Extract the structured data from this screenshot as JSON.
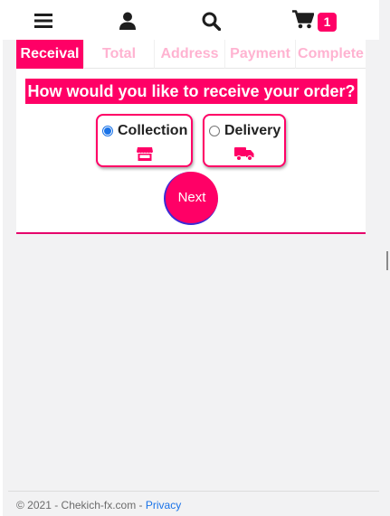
{
  "nav": {
    "menu_icon": "bars-icon",
    "user_icon": "user-icon",
    "search_icon": "search-icon",
    "cart_icon": "shopping-cart-icon",
    "cart_count": "1"
  },
  "tabs": [
    {
      "label": "Receival",
      "active": true
    },
    {
      "label": "Total",
      "active": false
    },
    {
      "label": "Address",
      "active": false
    },
    {
      "label": "Payment",
      "active": false
    },
    {
      "label": "Complete",
      "active": false
    }
  ],
  "question": "How would you like to receive your order?",
  "options": [
    {
      "label": "Collection",
      "checked": true,
      "icon": "store-icon"
    },
    {
      "label": "Delivery",
      "checked": false,
      "icon": "truck-icon"
    }
  ],
  "next_label": "Next",
  "footer": {
    "copyright": "© 2021 - Chekich-fx.com - ",
    "privacy_link": "Privacy"
  },
  "colors": {
    "accent": "#ff0066",
    "inactive_tab": "#ffb3d1",
    "link": "#1a73e8"
  }
}
